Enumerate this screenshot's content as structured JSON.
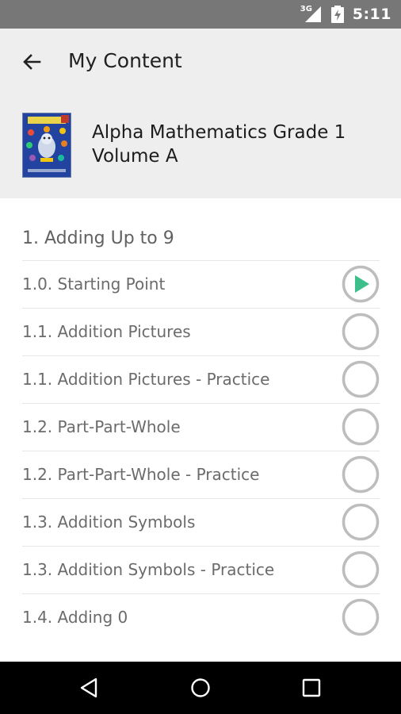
{
  "status_bar": {
    "network": "3G",
    "time": "5:11"
  },
  "header": {
    "title": "My Content"
  },
  "book": {
    "title": "Alpha Mathematics Grade 1 Volume A"
  },
  "section": {
    "title": "1. Adding Up to 9"
  },
  "lessons": [
    {
      "label": "1.0. Starting Point",
      "state": "play"
    },
    {
      "label": "1.1. Addition Pictures",
      "state": "empty"
    },
    {
      "label": "1.1. Addition Pictures - Practice",
      "state": "empty"
    },
    {
      "label": "1.2. Part-Part-Whole",
      "state": "empty"
    },
    {
      "label": "1.2. Part-Part-Whole - Practice",
      "state": "empty"
    },
    {
      "label": "1.3. Addition Symbols",
      "state": "empty"
    },
    {
      "label": "1.3. Addition Symbols - Practice",
      "state": "empty"
    },
    {
      "label": "1.4. Adding 0",
      "state": "empty"
    }
  ],
  "colors": {
    "accent": "#3dbf8c",
    "ring": "#bdbdbd",
    "appbar": "#eeeeee",
    "statusbar": "#777777"
  }
}
